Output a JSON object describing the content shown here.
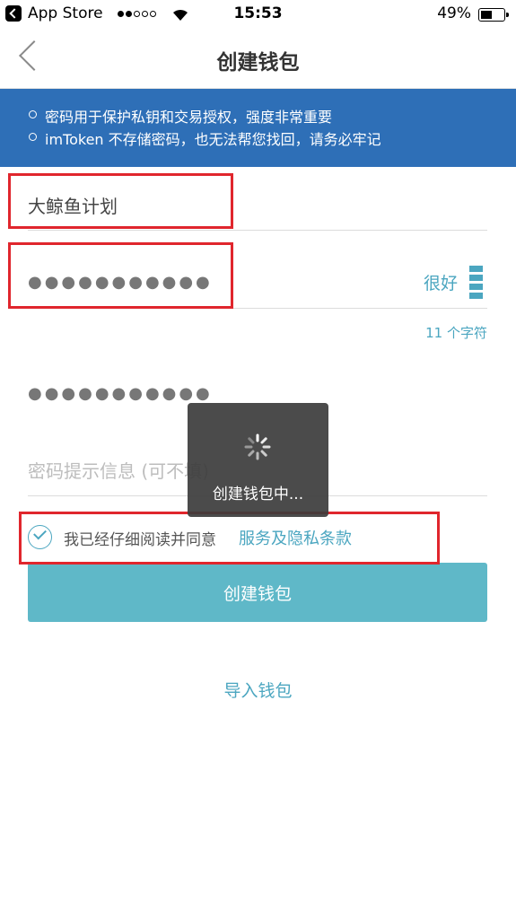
{
  "status_bar": {
    "back_app": "App Store",
    "time": "15:53",
    "battery": "49%"
  },
  "nav": {
    "title": "创建钱包"
  },
  "banner": {
    "lines": [
      "密码用于保护私钥和交易授权，强度非常重要",
      "imToken 不存储密码，也无法帮您找回，请务必牢记"
    ]
  },
  "form": {
    "wallet_name": "大鲸鱼计划",
    "password_mask": "●●●●●●●●●●●",
    "password_strength": "很好",
    "char_count": "11 个字符",
    "confirm_password_mask": "●●●●●●●●●●●",
    "hint_placeholder": "密码提示信息 (可不填)"
  },
  "agreement": {
    "text": "我已经仔细阅读并同意",
    "link": "服务及隐私条款",
    "checked": true
  },
  "buttons": {
    "create": "创建钱包",
    "import": "导入钱包"
  },
  "toast": {
    "message": "创建钱包中..."
  },
  "colors": {
    "banner": "#2e6fb7",
    "accent": "#4ba6c0",
    "button": "#5fb8c8",
    "highlight": "#e0262d"
  }
}
